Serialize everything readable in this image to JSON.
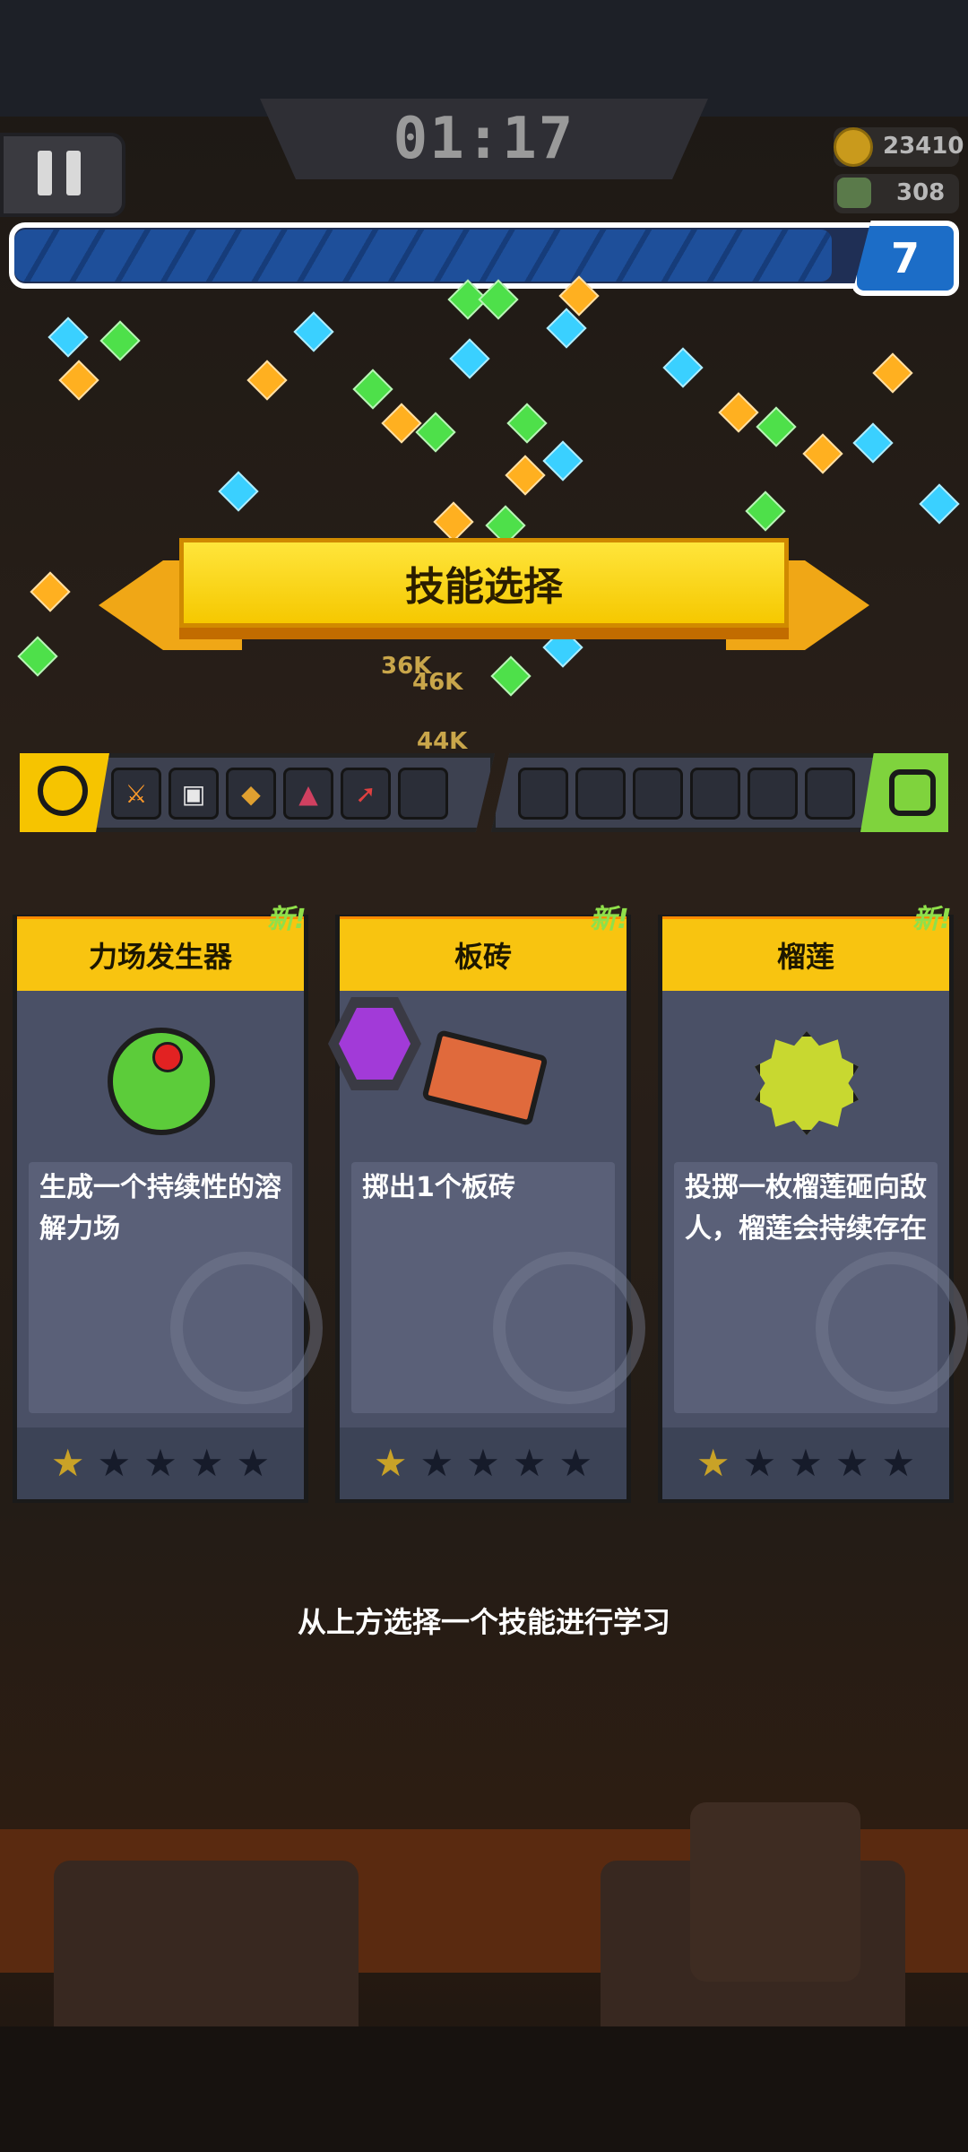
{
  "hud": {
    "timer": "01:17",
    "coins": "23410",
    "kills": "308",
    "level": "7",
    "xp_progress": 0.88
  },
  "banner": {
    "title": "技能选择"
  },
  "damage_numbers": [
    "36K",
    "46K",
    "44K"
  ],
  "equipped_skills": {
    "left": [
      "sword-icon",
      "robot-icon",
      "drill-icon",
      "cone-icon",
      "rocket-icon",
      ""
    ],
    "right": [
      "",
      "",
      "",
      "",
      "",
      ""
    ]
  },
  "cards": [
    {
      "new_label": "新!",
      "title": "力场发生器",
      "description": "生成一个持续性的溶解力场",
      "icon": "force-field-icon",
      "stars": 1,
      "max_stars": 5
    },
    {
      "new_label": "新!",
      "title": "板砖",
      "description": "掷出1个板砖",
      "icon": "brick-icon",
      "stars": 1,
      "max_stars": 5,
      "badge": "purple-hexagon-badge"
    },
    {
      "new_label": "新!",
      "title": "榴莲",
      "description": "投掷一枚榴莲砸向敌人，榴莲会持续存在",
      "icon": "durian-icon",
      "stars": 1,
      "max_stars": 5
    }
  ],
  "hint": "从上方选择一个技能进行学习",
  "colors": {
    "card_header": "#f8c410",
    "banner": "#ffe53b",
    "xp_bar": "#1e4f9a",
    "star_on": "#c9a227",
    "new_tag": "#8fe04a"
  }
}
